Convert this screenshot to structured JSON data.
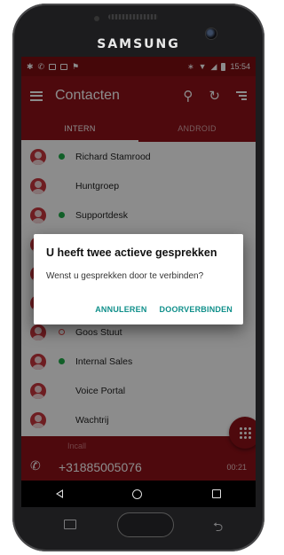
{
  "device": {
    "brand": "SAMSUNG"
  },
  "status_bar": {
    "time": "15:54"
  },
  "app_bar": {
    "title": "Contacten"
  },
  "tabs": [
    {
      "label": "INTERN",
      "active": true
    },
    {
      "label": "ANDROID",
      "active": false
    }
  ],
  "contacts": [
    {
      "name": "Richard Stamrood",
      "presence": "online"
    },
    {
      "name": "Huntgroep",
      "presence": "none"
    },
    {
      "name": "Supportdesk",
      "presence": "online"
    },
    {
      "name": "",
      "presence": "none"
    },
    {
      "name": "",
      "presence": "none"
    },
    {
      "name": "",
      "presence": "none"
    },
    {
      "name": "Goos Stuut",
      "presence": "busy"
    },
    {
      "name": "Internal Sales",
      "presence": "online"
    },
    {
      "name": "Voice Portal",
      "presence": "none"
    },
    {
      "name": "Wachtrij",
      "presence": "none"
    }
  ],
  "call_bar": {
    "peek_label": "Incall",
    "number": "+31885005076",
    "timer": "00:21"
  },
  "dialog": {
    "title": "U heeft twee actieve gesprekken",
    "message": "Wenst u gesprekken door te verbinden?",
    "cancel_label": "ANNULEREN",
    "confirm_label": "DOORVERBINDEN"
  },
  "colors": {
    "primary": "#8e1118",
    "status_bar": "#7f0d12",
    "presence_online": "#1fae4a",
    "dialog_action": "#0f8f8a"
  }
}
